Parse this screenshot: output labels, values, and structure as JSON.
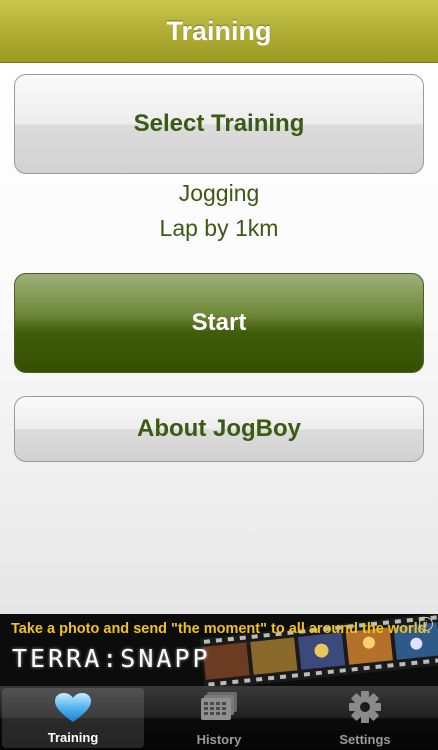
{
  "nav": {
    "title": "Training"
  },
  "main": {
    "select_button": "Select Training",
    "training_type": "Jogging",
    "lap_setting": "Lap by 1km",
    "start_button": "Start",
    "about_button": "About JogBoy"
  },
  "ad": {
    "tagline": "Take a photo and send  \"the moment\" to all around the world.",
    "brand": "TERRA:SNAPP",
    "info_icon": "i"
  },
  "tabbar": {
    "tabs": [
      {
        "label": "Training",
        "icon": "heart-icon",
        "active": true
      },
      {
        "label": "History",
        "icon": "history-icon",
        "active": false
      },
      {
        "label": "Settings",
        "icon": "gear-icon",
        "active": false
      }
    ]
  },
  "colors": {
    "nav": "#b2b036",
    "text_green": "#3c5a14",
    "start_button": "#3f5c0b",
    "ad_text": "#f2c21c"
  }
}
